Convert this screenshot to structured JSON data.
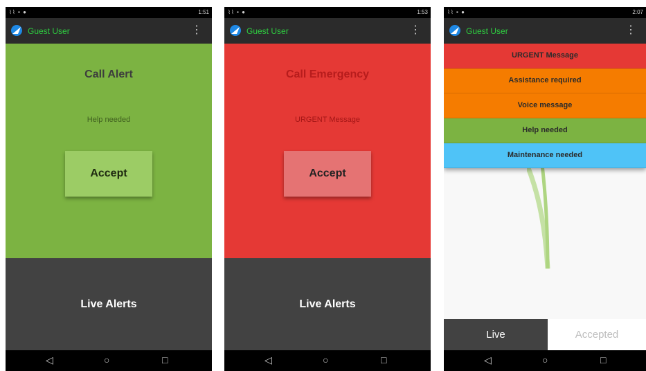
{
  "user": "Guest User",
  "phones": [
    {
      "status_time": "1:51",
      "alert_title": "Call Alert",
      "alert_message": "Help needed",
      "accept_label": "Accept",
      "live_label": "Live Alerts",
      "alert_color": "#7cb342"
    },
    {
      "status_time": "1:53",
      "alert_title": "Call Emergency",
      "alert_message": "URGENT Message",
      "accept_label": "Accept",
      "live_label": "Live Alerts",
      "alert_color": "#e53935"
    },
    {
      "status_time": "2:07",
      "messages": [
        {
          "label": "URGENT Message",
          "color": "#e53935"
        },
        {
          "label": "Assistance required",
          "color": "#f57c00"
        },
        {
          "label": "Voice message",
          "color": "#f57c00"
        },
        {
          "label": "Help needed",
          "color": "#7cb342"
        },
        {
          "label": "Maintenance needed",
          "color": "#4fc3f7"
        }
      ],
      "tabs": {
        "live": "Live",
        "accepted": "Accepted"
      }
    }
  ],
  "nav_icons": [
    "back-icon",
    "home-icon",
    "recents-icon"
  ]
}
